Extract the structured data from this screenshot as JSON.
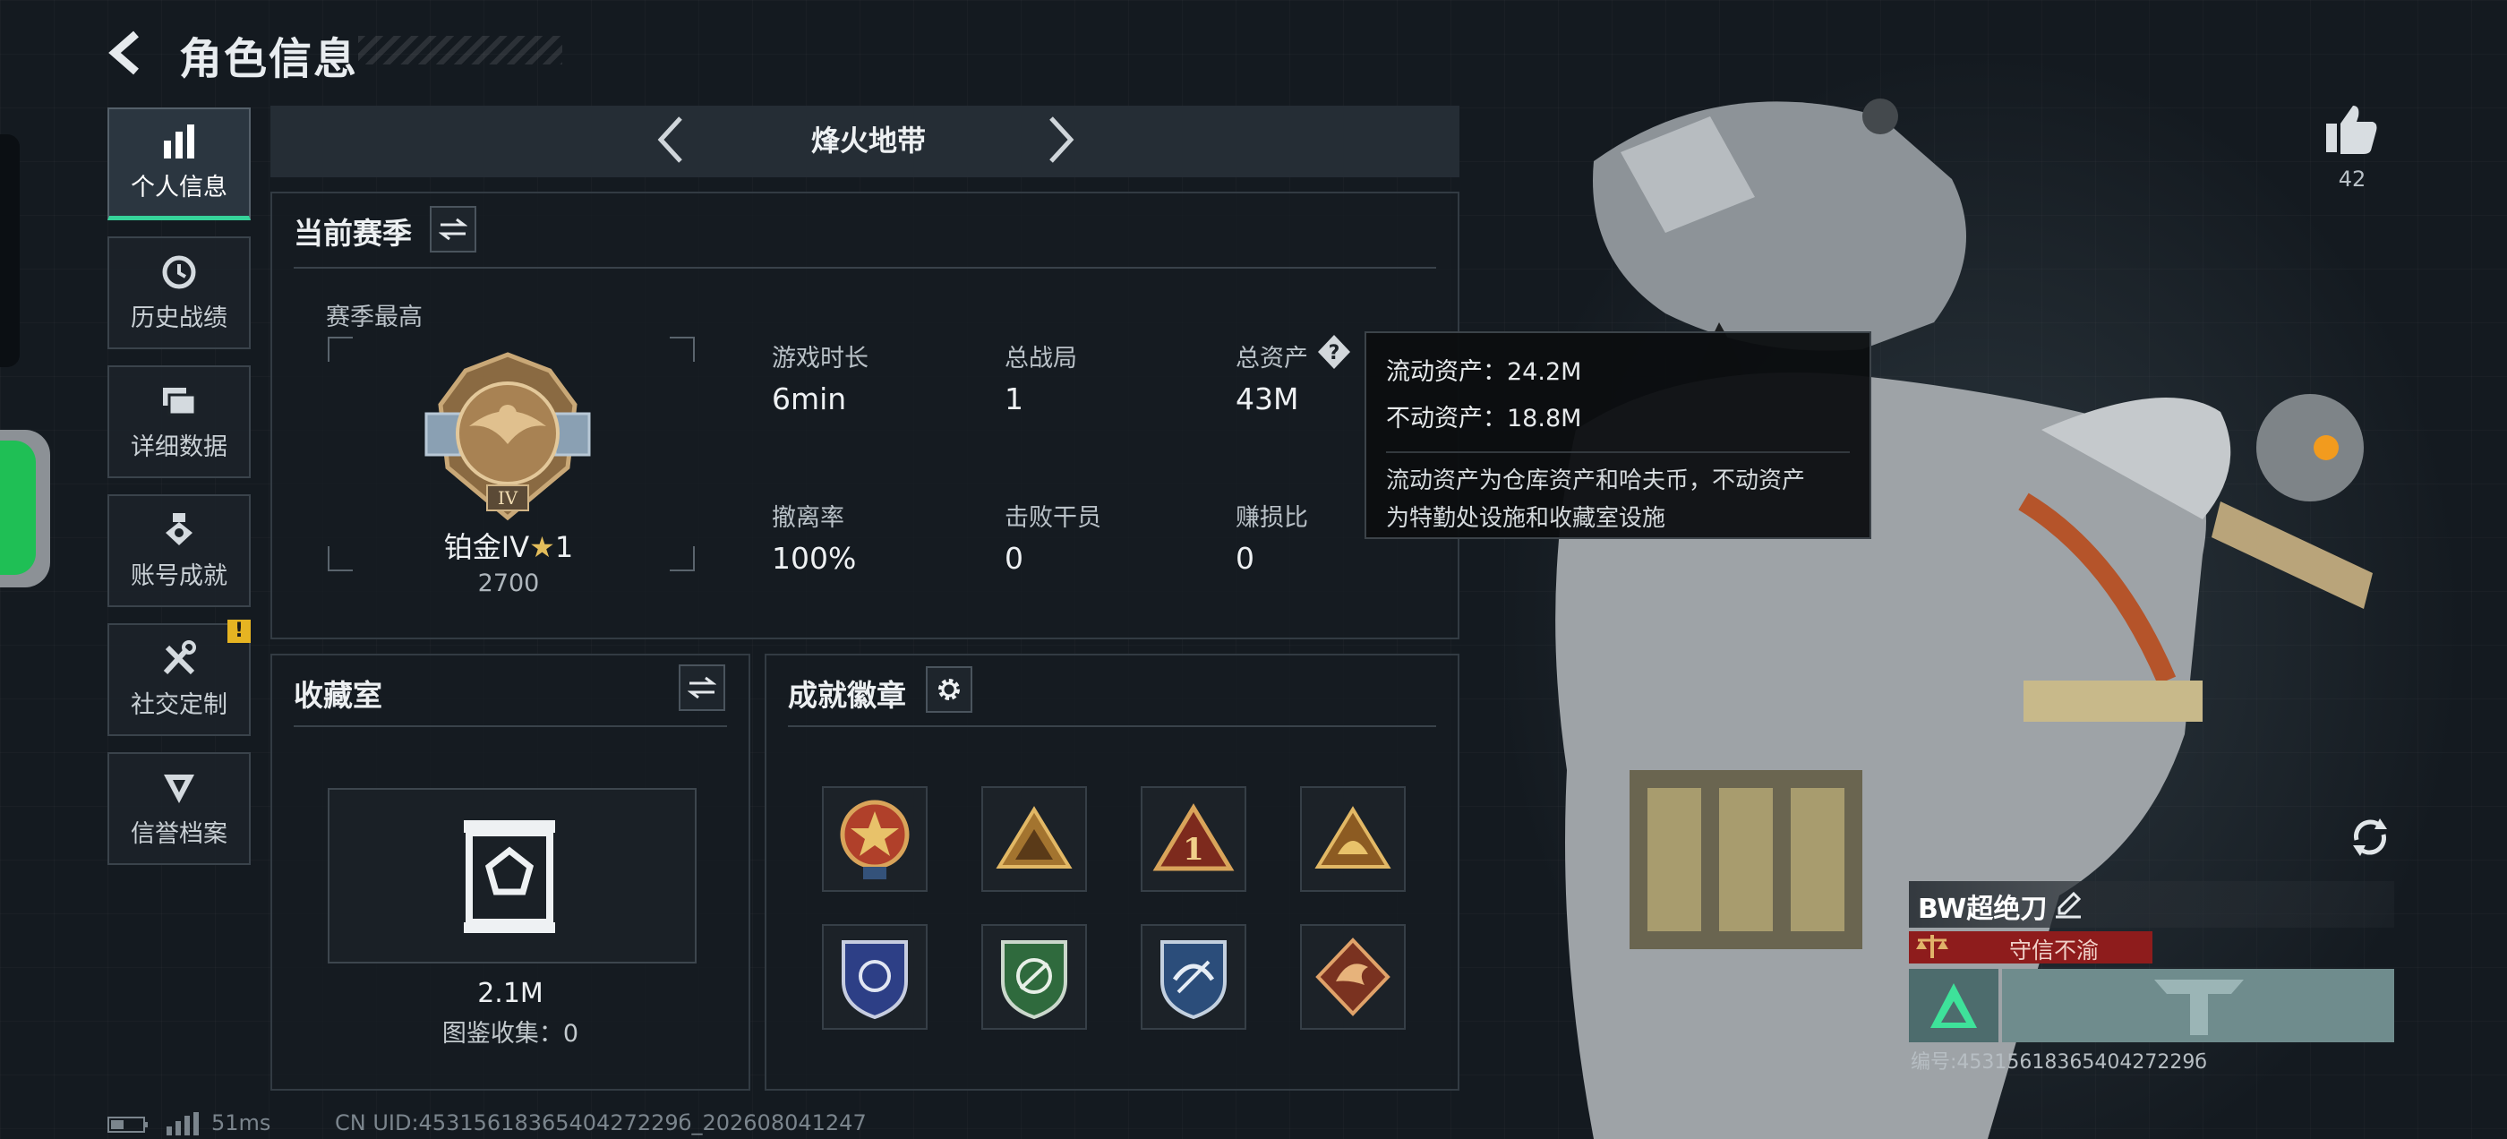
{
  "header": {
    "title": "角色信息"
  },
  "sidebar": {
    "items": [
      {
        "label": "个人信息",
        "icon": "bar-chart-icon",
        "active": true
      },
      {
        "label": "历史战绩",
        "icon": "history-clock-icon"
      },
      {
        "label": "详细数据",
        "icon": "folders-icon"
      },
      {
        "label": "账号成就",
        "icon": "achievement-icon"
      },
      {
        "label": "社交定制",
        "icon": "tools-icon",
        "alert": "!"
      },
      {
        "label": "信誉档案",
        "icon": "reputation-icon"
      }
    ]
  },
  "season_nav": {
    "name": "烽火地带"
  },
  "current_season": {
    "title": "当前赛季",
    "best_label": "赛季最高",
    "rank_name": "铂金IV",
    "rank_stars": "1",
    "rank_score": "2700",
    "stats": [
      {
        "label": "游戏时长",
        "value": "6min"
      },
      {
        "label": "总战局",
        "value": "1"
      },
      {
        "label": "总资产",
        "value": "43M"
      },
      {
        "label": "撤离率",
        "value": "100%"
      },
      {
        "label": "击败干员",
        "value": "0"
      },
      {
        "label": "赚损比",
        "value": "0"
      }
    ]
  },
  "tooltip": {
    "liquid": "流动资产：24.2M",
    "fixed": "不动资产：18.8M",
    "desc1": "流动资产为仓库资产和哈夫币，不动资产",
    "desc2": "为特勤处设施和收藏室设施"
  },
  "collection": {
    "title": "收藏室",
    "value": "2.1M",
    "catalog": "图鉴收集：0"
  },
  "badges": {
    "title": "成就徽章",
    "items": [
      "star-medal-icon",
      "camp-badge-icon",
      "number-one-badge-icon",
      "helmet-badge-icon",
      "eagle-shield-icon",
      "green-shield-icon",
      "blue-wing-shield-icon",
      "dragon-badge-icon"
    ]
  },
  "likes": {
    "count": "42"
  },
  "player": {
    "name": "BW超绝刀",
    "reputation": "守信不渝",
    "id_text": "编号:4531561836540427229б"
  },
  "status": {
    "ping": "51ms",
    "uid": "CN UID:4531561836540427229б_202608041247"
  },
  "colors": {
    "accent_green": "#36d39a",
    "reputation_red": "#8e1c1c",
    "warn_yellow": "#e6b422"
  }
}
